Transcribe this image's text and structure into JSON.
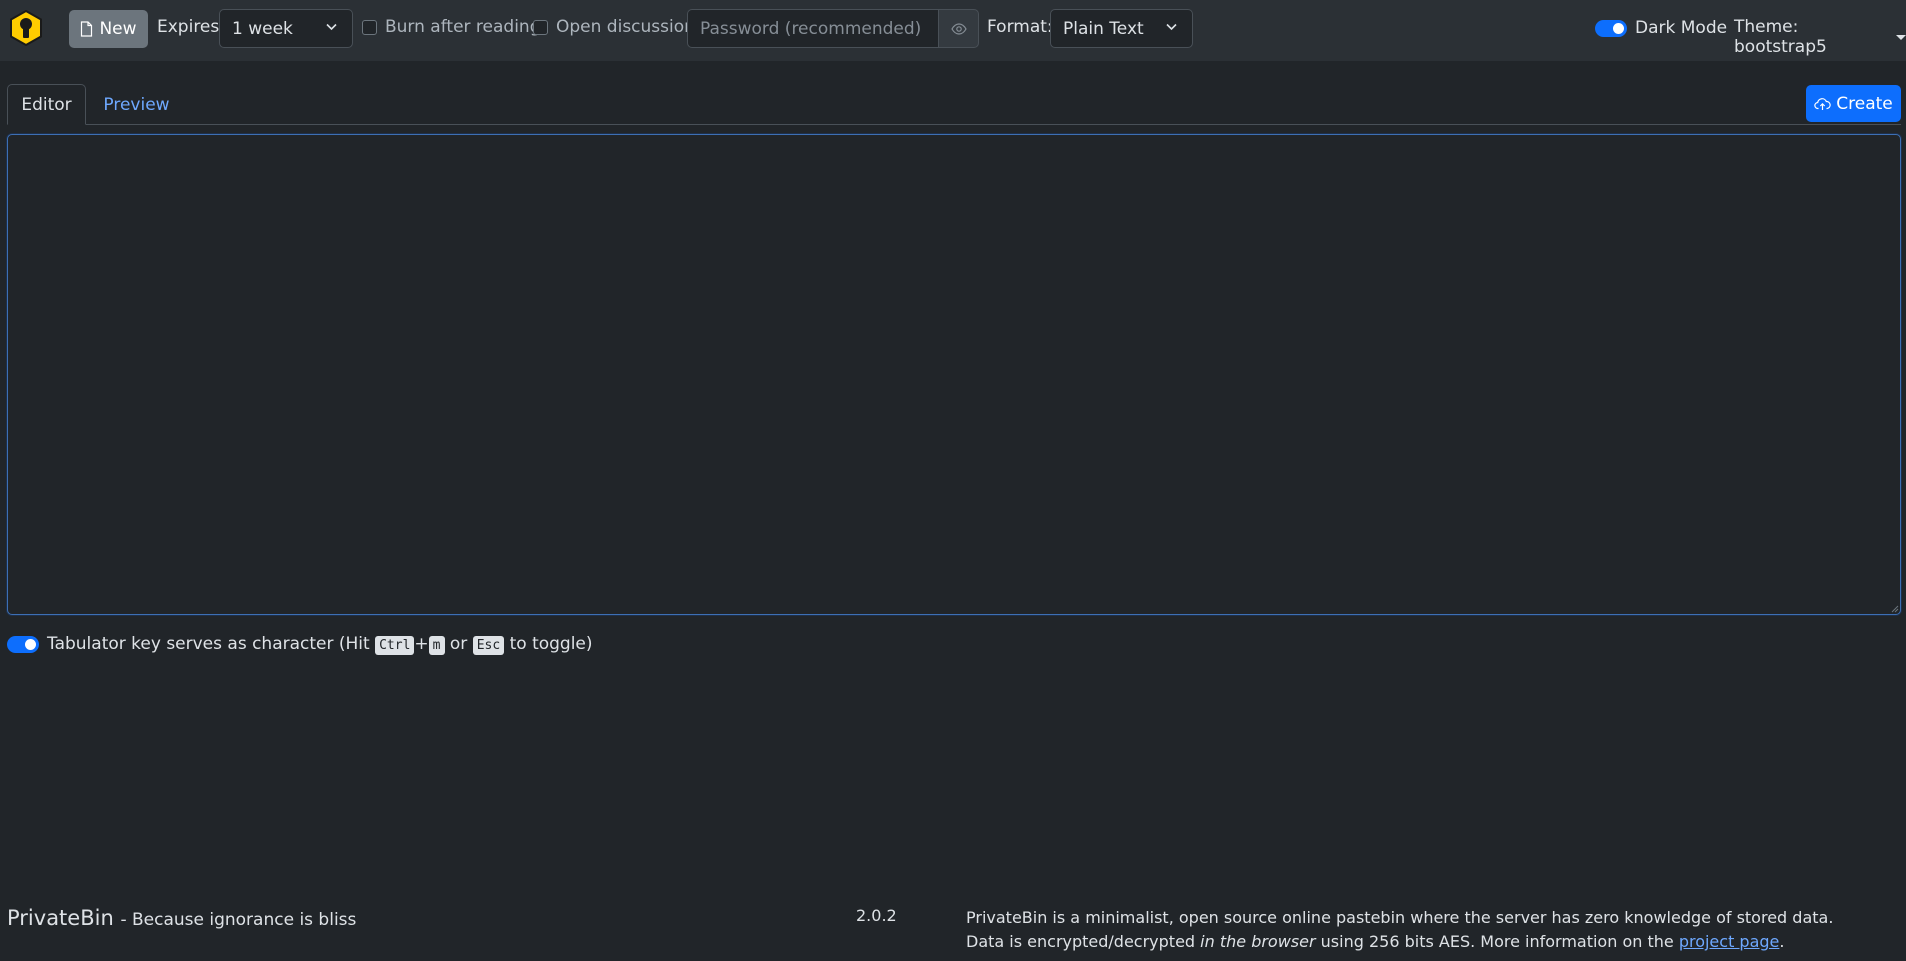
{
  "navbar": {
    "new_label": "New",
    "expires_label": "Expires:",
    "expires_value": "1 week",
    "burn_label": "Burn after reading",
    "discussion_label": "Open discussion",
    "password_placeholder": "Password (recommended)",
    "format_label": "Format:",
    "format_value": "Plain Text",
    "dark_mode_label": "Dark Mode",
    "theme_label": "Theme: bootstrap5"
  },
  "tabs": [
    {
      "label": "Editor"
    },
    {
      "label": "Preview"
    }
  ],
  "create_label": "Create",
  "tab_toggle": {
    "prefix": "Tabulator key serves as character (Hit",
    "key1": "Ctrl",
    "plus": "+",
    "key2": "m",
    "or": "or",
    "key3": "Esc",
    "suffix": "to toggle)"
  },
  "footer": {
    "brand": "PrivateBin",
    "tagline": "- Because ignorance is bliss",
    "version": "2.0.2",
    "info_part1": "PrivateBin is a minimalist, open source online pastebin where the server has zero knowledge of stored data. Data is encrypted/decrypted",
    "info_em": "in the browser",
    "info_part2": "using 256 bits AES. More information on the",
    "info_link": "project page",
    "info_end": "."
  },
  "colors": {
    "background": "#212529",
    "navbar": "#2b3035",
    "accent": "#0d6efd",
    "logo": "#ffcc00"
  },
  "icons": [
    "privatebin-logo-icon",
    "file-icon",
    "chevron-down-icon",
    "eye-icon",
    "cloud-upload-icon",
    "caret-down-icon"
  ]
}
